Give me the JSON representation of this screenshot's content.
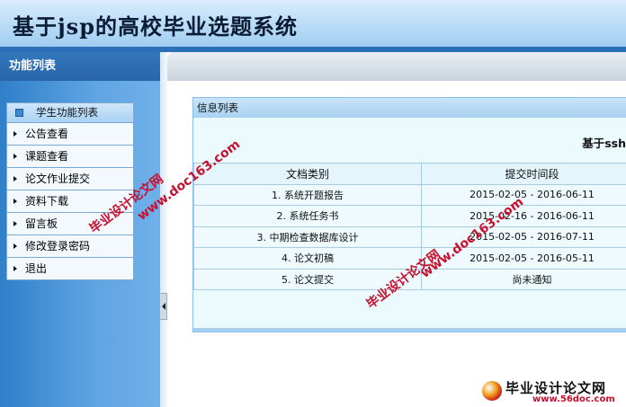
{
  "header": {
    "title": "基于jsp的高校毕业选题系统"
  },
  "sidebar": {
    "title": "功能列表",
    "group_label": "学生功能列表",
    "items": [
      {
        "label": "公告查看"
      },
      {
        "label": "课题查看"
      },
      {
        "label": "论文作业提交"
      },
      {
        "label": "资料下载"
      },
      {
        "label": "留言板"
      },
      {
        "label": "修改登录密码"
      },
      {
        "label": "退出"
      }
    ]
  },
  "main": {
    "panel_title": "信息列表",
    "welcome": "基于ssh",
    "table": {
      "headers": [
        "文档类别",
        "提交时间段"
      ],
      "rows": [
        {
          "category": "1. 系统开题报告",
          "period": "2015-02-05 - 2016-06-11"
        },
        {
          "category": "2. 系统任务书",
          "period": "2015-02-16 - 2016-06-11"
        },
        {
          "category": "3. 中期检查数据库设计",
          "period": "2015-02-05 - 2016-07-11"
        },
        {
          "category": "4. 论文初稿",
          "period": "2015-02-05 - 2016-05-11"
        },
        {
          "category": "5. 论文提交",
          "period": "尚未通知"
        }
      ]
    }
  },
  "watermarks": {
    "site_name": "毕业设计论文网",
    "site_url": "www.doc163.com",
    "logo_text": "毕业设计论文网",
    "logo_url": "www.56doc.com"
  }
}
